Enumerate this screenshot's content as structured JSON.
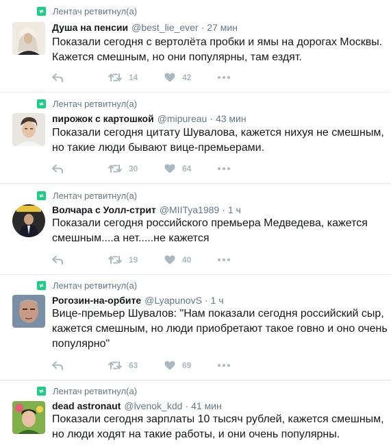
{
  "retweet_label": "Лентач ретвитнул(а)",
  "tweets": [
    {
      "name": "Душа на пенсии",
      "handle": "@best_lie_ever",
      "time": "27 мин",
      "text": "Показали сегодня с вертолёта пробки и ямы на дорогах Москвы. Кажется смешным, но они популярны, там ездят.",
      "retweets": "14",
      "likes": "42"
    },
    {
      "name": "пирожок с картошкой",
      "handle": "@mipureau",
      "time": "43 мин",
      "text": "Показали сегодня цитату Шувалова, кажется нихуя не смешным, но такие люди бывают вице-премьерами.",
      "retweets": "30",
      "likes": "64"
    },
    {
      "name": "Волчара с Уолл-стрит",
      "handle": "@MIITya1989",
      "time": "1 ч",
      "text": "Показали сегодня российского премьера Медведева, кажется смешным....а нет.....не кажется",
      "retweets": "19",
      "likes": "40"
    },
    {
      "name": "Рогозин-на-орбите",
      "handle": "@LyapunovS",
      "time": "1 ч",
      "text": "Вице-премьер Шувалов: \"Нам показали сегодня российский сыр, кажется смешным, но люди приобретают такое говно и оно очень популярно\"",
      "retweets": "63",
      "likes": "69"
    },
    {
      "name": "dead astronaut",
      "handle": "@lvenok_kdd",
      "time": "41 мин",
      "text": "Показали сегодня зарплаты 10 тысяч рублей, кажется смешным, но люди ходят на такие работы, и они очень популярны.",
      "retweets": "",
      "likes": ""
    }
  ],
  "colors": {
    "retweet_green": "#19cf86",
    "muted": "#657786",
    "icon": "#aab8c2",
    "divider": "#e6ecf0"
  }
}
